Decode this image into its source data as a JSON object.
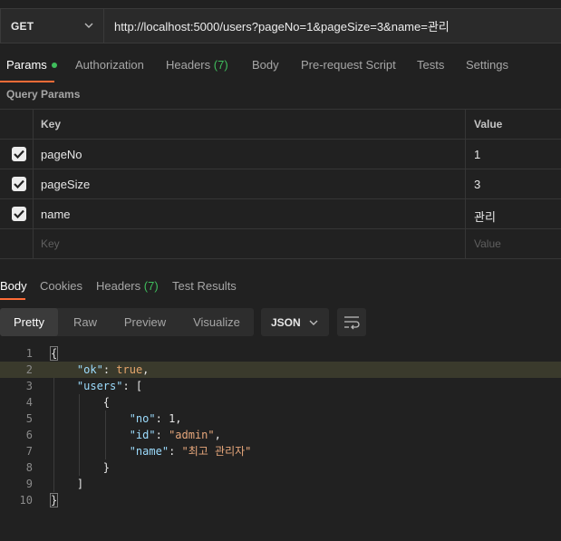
{
  "request": {
    "method": "GET",
    "url": "http://localhost:5000/users?pageNo=1&pageSize=3&name=관리"
  },
  "request_tabs": [
    {
      "label": "Params",
      "active": true,
      "dot": true
    },
    {
      "label": "Authorization"
    },
    {
      "label": "Headers",
      "count": "(7)"
    },
    {
      "label": "Body"
    },
    {
      "label": "Pre-request Script"
    },
    {
      "label": "Tests"
    },
    {
      "label": "Settings"
    }
  ],
  "query_params": {
    "title": "Query Params",
    "headers": {
      "key": "Key",
      "value": "Value"
    },
    "rows": [
      {
        "key": "pageNo",
        "value": "1",
        "checked": true
      },
      {
        "key": "pageSize",
        "value": "3",
        "checked": true
      },
      {
        "key": "name",
        "value": "관리",
        "checked": true
      }
    ],
    "placeholder": {
      "key": "Key",
      "value": "Value"
    }
  },
  "response_tabs": [
    {
      "label": "Body",
      "active": true
    },
    {
      "label": "Cookies"
    },
    {
      "label": "Headers",
      "count": "(7)"
    },
    {
      "label": "Test Results"
    }
  ],
  "view_modes": [
    "Pretty",
    "Raw",
    "Preview",
    "Visualize"
  ],
  "active_view": "Pretty",
  "format": "JSON",
  "code": {
    "lines": [
      "1",
      "2",
      "3",
      "4",
      "5",
      "6",
      "7",
      "8",
      "9",
      "10"
    ],
    "ok_key": "\"ok\"",
    "ok_val": "true",
    "users_key": "\"users\"",
    "no_key": "\"no\"",
    "no_val": "1",
    "id_key": "\"id\"",
    "id_val": "\"admin\"",
    "name_key": "\"name\"",
    "name_val": "\"최고 관리자\""
  },
  "icons": [
    "chevron-down-icon",
    "checkbox-checked-icon",
    "wrap-lines-icon"
  ],
  "colors": {
    "accent": "#ff6c37",
    "success": "#3fbe5c",
    "key": "#9cdcfe",
    "string": "#e8a87c"
  }
}
